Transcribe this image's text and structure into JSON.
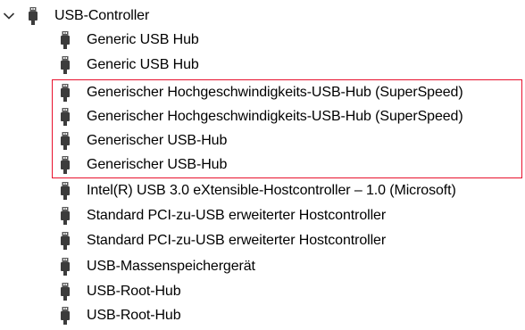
{
  "tree": {
    "root": {
      "label": "USB-Controller",
      "icon": "usb-connector-icon",
      "expanded": true
    },
    "children": [
      {
        "label": "Generic USB Hub"
      },
      {
        "label": "Generic USB Hub"
      },
      {
        "label": "Generischer Hochgeschwindigkeits-USB-Hub (SuperSpeed)"
      },
      {
        "label": "Generischer Hochgeschwindigkeits-USB-Hub (SuperSpeed)"
      },
      {
        "label": "Generischer USB-Hub"
      },
      {
        "label": "Generischer USB-Hub"
      },
      {
        "label": "Intel(R) USB 3.0 eXtensible-Hostcontroller – 1.0 (Microsoft)"
      },
      {
        "label": "Standard PCI-zu-USB erweiterter Hostcontroller"
      },
      {
        "label": "Standard PCI-zu-USB erweiterter Hostcontroller"
      },
      {
        "label": "USB-Massenspeichergerät"
      },
      {
        "label": "USB-Root-Hub"
      },
      {
        "label": "USB-Root-Hub"
      }
    ]
  },
  "highlight": {
    "color": "#e8112d"
  }
}
